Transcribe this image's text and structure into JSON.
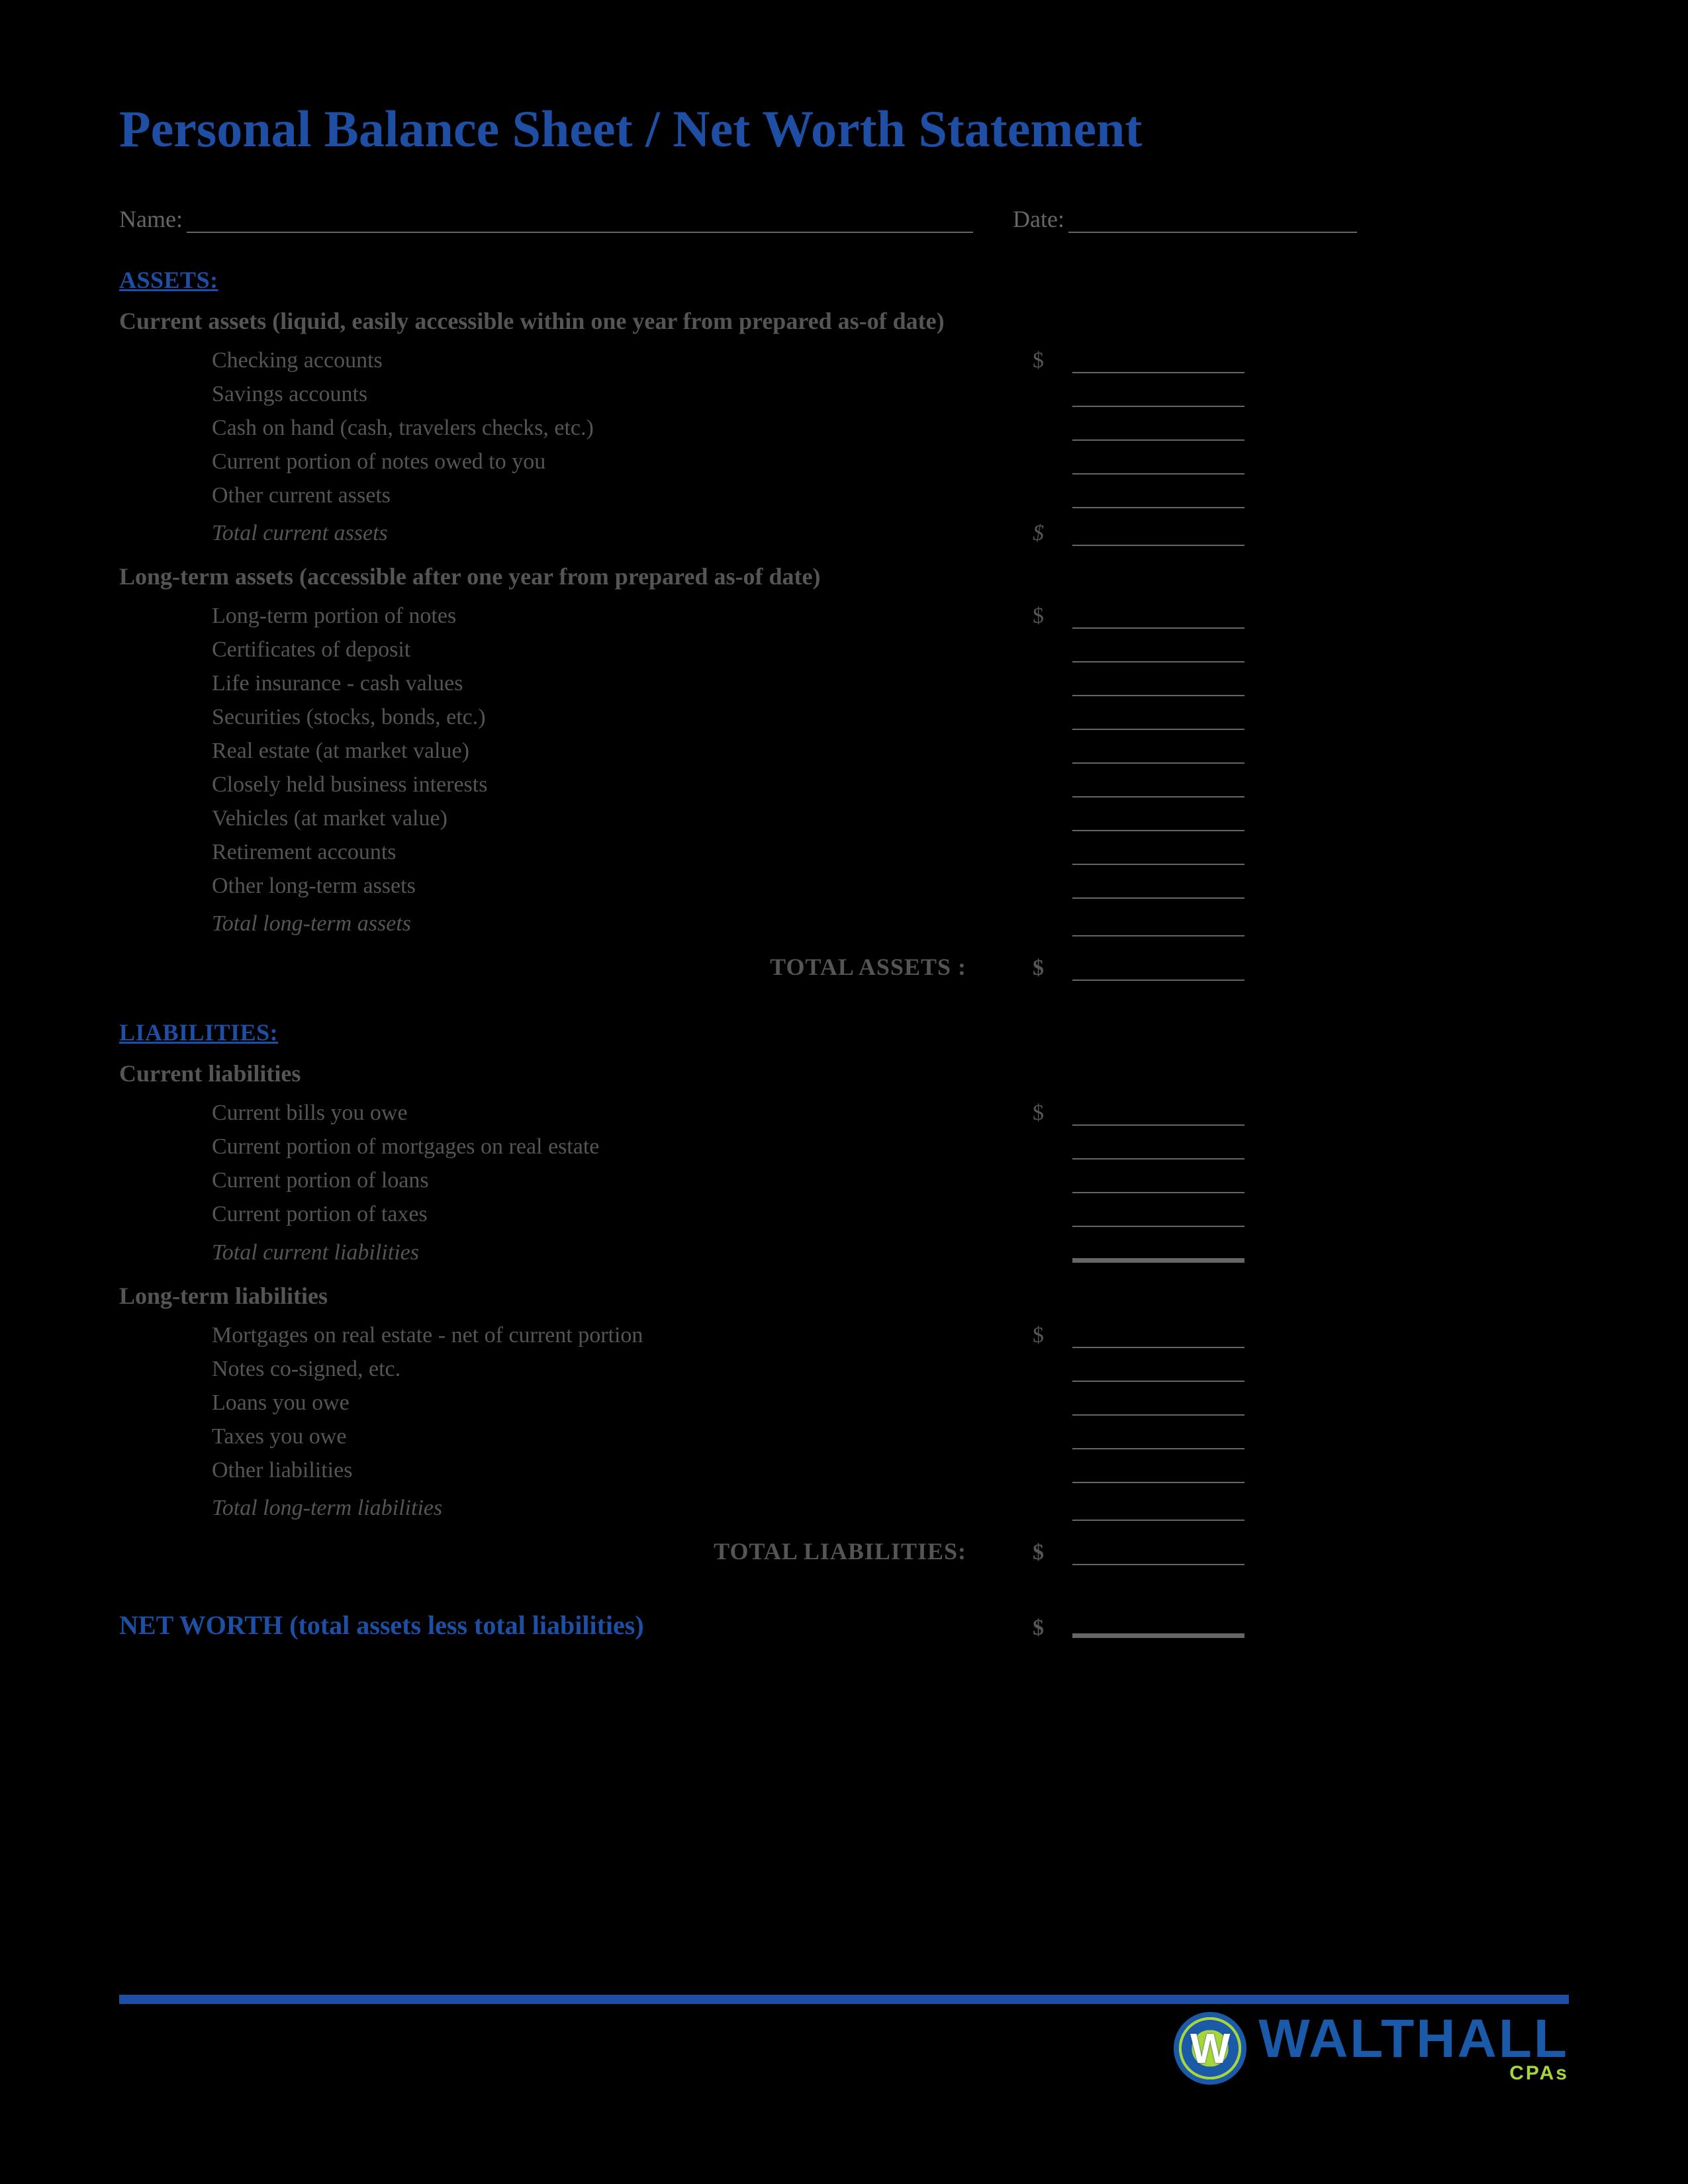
{
  "title": "Personal Balance Sheet / Net Worth Statement",
  "header": {
    "name_label": "Name:",
    "date_label": "Date:"
  },
  "dollar": "$",
  "assets": {
    "heading": "ASSETS:",
    "current": {
      "heading": "Current assets (liquid, easily accessible within one year from prepared as-of date)",
      "items": [
        "Checking accounts",
        "Savings accounts",
        "Cash on hand (cash, travelers checks, etc.)",
        "Current portion of notes owed to you",
        "Other current assets"
      ],
      "total_label": "Total current assets"
    },
    "longterm": {
      "heading": "Long-term assets (accessible after one year from prepared as-of date)",
      "items": [
        "Long-term portion of notes",
        "Certificates of deposit",
        "Life insurance - cash values",
        "Securities (stocks, bonds, etc.)",
        "Real estate (at market value)",
        "Closely held business interests",
        "Vehicles (at market value)",
        "Retirement accounts",
        "Other long-term assets"
      ],
      "total_label": "Total long-term assets"
    },
    "grand_total_label": "TOTAL ASSETS :"
  },
  "liabilities": {
    "heading": "LIABILITIES:",
    "current": {
      "heading": "Current liabilities",
      "items": [
        "Current bills you owe",
        "Current portion of mortgages on real estate",
        "Current portion of loans",
        "Current portion of taxes"
      ],
      "total_label": "Total current liabilities"
    },
    "longterm": {
      "heading": "Long-term liabilities",
      "items": [
        "Mortgages on real estate - net of current portion",
        "Notes co-signed, etc.",
        "Loans you owe",
        "Taxes you owe",
        "Other liabilities"
      ],
      "total_label": "Total long-term liabilities"
    },
    "grand_total_label": "TOTAL LIABILITIES:"
  },
  "networth_label": "NET WORTH (total assets less total liabilities)",
  "footer": {
    "logo_letter": "W",
    "company": "WALTHALL",
    "subtitle": "CPAs"
  }
}
